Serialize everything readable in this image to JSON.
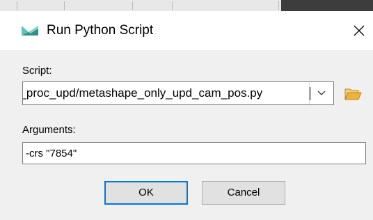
{
  "dialog": {
    "title": "Run Python Script",
    "close_glyph": "✕",
    "icon": "metashape-app-icon",
    "script_label": "Script:",
    "script_value": "a_proc_upd/metashape_only_upd_cam_pos.py",
    "dropdown_icon": "chevron-down-icon",
    "browse_icon": "folder-open-icon",
    "arguments_label": "Arguments:",
    "arguments_value": "-crs \"7854\"",
    "ok_label": "OK",
    "cancel_label": "Cancel"
  },
  "colors": {
    "titlebar": "#ffffff",
    "body": "#f0f0f0",
    "focus_border": "#0078d7",
    "button_face": "#e1e1e1",
    "icon_teal": "#3aa6a0",
    "folder_yellow": "#e8b53a"
  }
}
